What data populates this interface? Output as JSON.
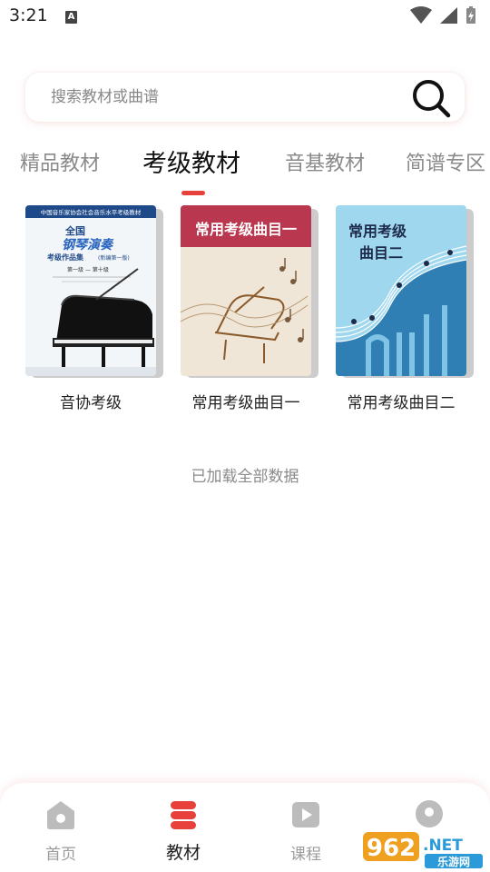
{
  "status_bar": {
    "time": "3:21",
    "notification_letter": "A"
  },
  "search": {
    "placeholder": "搜索教材或曲谱"
  },
  "tabs": [
    {
      "label": "精品教材",
      "active": false
    },
    {
      "label": "考级教材",
      "active": true
    },
    {
      "label": "音基教材",
      "active": false
    },
    {
      "label": "简谱专区",
      "active": false
    }
  ],
  "books": [
    {
      "title": "音协考级",
      "cover": {
        "header": "中国音乐家协会社会音乐水平考级教材",
        "line1": "全国",
        "line2": "钢琴演奏",
        "line3": "考级作品集",
        "line3b": "(新编第一版)",
        "line4": "第一级 — 第十级"
      }
    },
    {
      "title": "常用考级曲目一",
      "cover": {
        "banner": "常用考级曲目一"
      }
    },
    {
      "title": "常用考级曲目二",
      "cover": {
        "line1": "常用考级",
        "line2": "曲目二"
      }
    }
  ],
  "status_message": "已加载全部数据",
  "bottom_nav": [
    {
      "label": "首页",
      "icon": "home-icon",
      "active": false
    },
    {
      "label": "教材",
      "icon": "textbook-icon",
      "active": true
    },
    {
      "label": "课程",
      "icon": "course-play-icon",
      "active": false
    },
    {
      "label": "",
      "icon": "profile-icon",
      "active": false
    }
  ],
  "watermark": {
    "number": "962",
    "suffix": ".NET",
    "subtitle": "乐游网"
  },
  "colors": {
    "accent": "#e8413b",
    "book2_banner": "#b9384f",
    "book3_bg": "#9fd7ef"
  }
}
